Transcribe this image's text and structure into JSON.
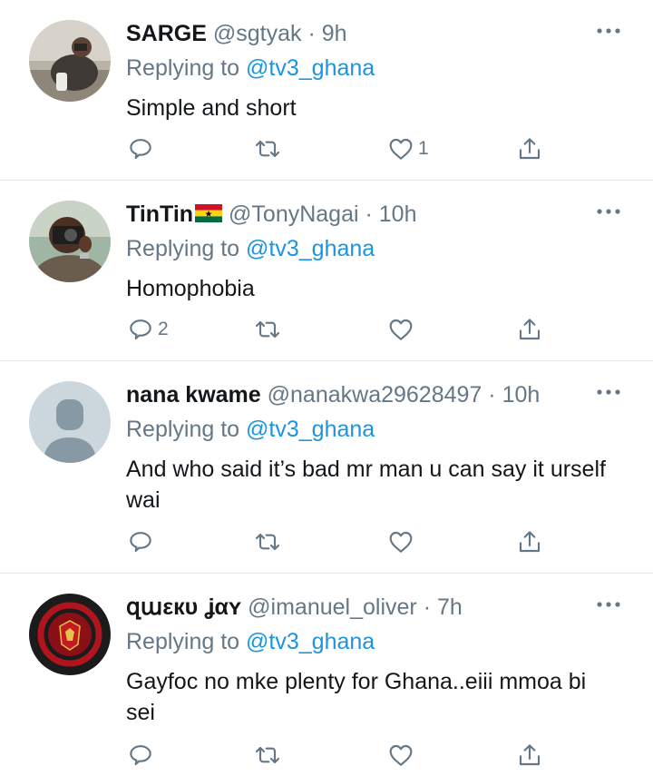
{
  "tweets": [
    {
      "name": "SARGE",
      "handle": "@sgtyak",
      "time": "9h",
      "replying_label": "Replying to",
      "replying_handle": "@tv3_ghana",
      "text": "Simple and short",
      "reply_count": "",
      "like_count": "1",
      "avatar": "photo-man-at-table"
    },
    {
      "name": "TinTin",
      "flag": "ghana-flag",
      "handle": "@TonyNagai",
      "time": "10h",
      "replying_label": "Replying to",
      "replying_handle": "@tv3_ghana",
      "text": "Homophobia",
      "reply_count": "2",
      "like_count": "",
      "avatar": "photo-man-with-camera"
    },
    {
      "name": "nana kwame",
      "handle": "@nanakwa29628497",
      "time": "10h",
      "replying_label": "Replying to",
      "replying_handle": "@tv3_ghana",
      "text": "And who said it’s bad mr man u can say it urself wai",
      "reply_count": "",
      "like_count": "",
      "avatar": "default-profile"
    },
    {
      "name": "զաεкυ ʝαʏ",
      "handle": "@imanuel_oliver",
      "time": "7h",
      "replying_label": "Replying to",
      "replying_handle": "@tv3_ghana",
      "text": "Gayfoc no mke plenty for Ghana..eiii mmoa bi sei",
      "reply_count": "",
      "like_count": "",
      "avatar": "manchester-united-crest"
    }
  ],
  "separator": "·",
  "colors": {
    "link": "#1b95e0",
    "secondary": "#657786",
    "divider": "#e1e8ed",
    "text": "#14171a"
  }
}
